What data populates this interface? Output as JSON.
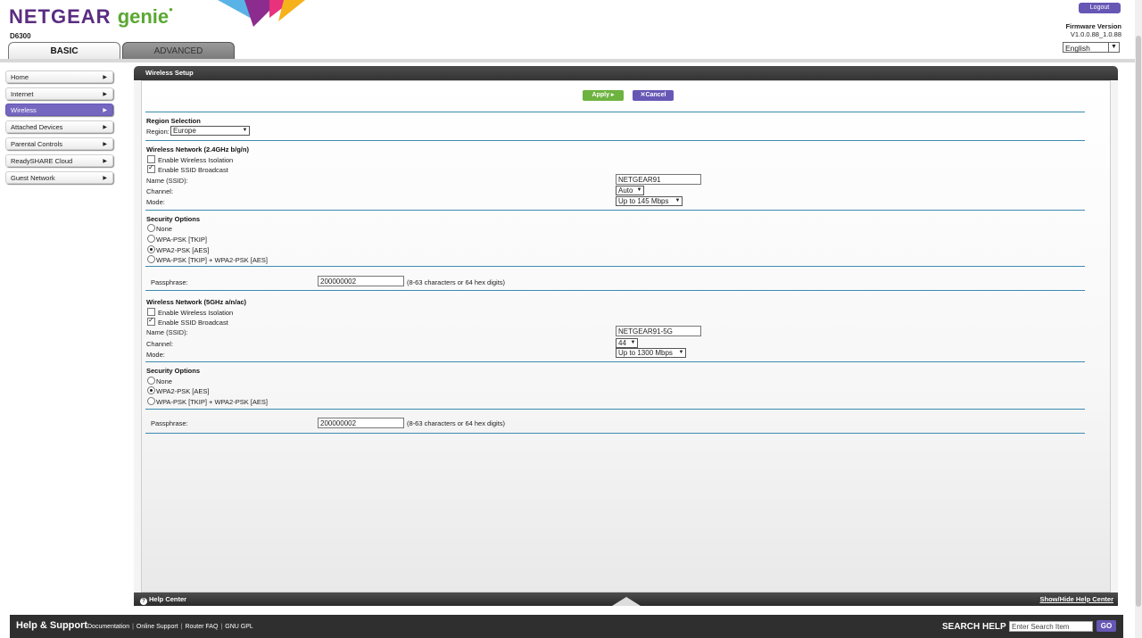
{
  "header": {
    "brand": "NETGEAR",
    "product": "genie",
    "model": "D6300",
    "logout_label": "Logout",
    "firmware_label": "Firmware Version",
    "firmware_value": "V1.0.0.88_1.0.88",
    "language": "English",
    "tabs": [
      {
        "label": "BASIC",
        "active": true
      },
      {
        "label": "ADVANCED",
        "active": false
      }
    ]
  },
  "sidebar": {
    "items": [
      {
        "label": "Home"
      },
      {
        "label": "Internet"
      },
      {
        "label": "Wireless",
        "active": true
      },
      {
        "label": "Attached Devices"
      },
      {
        "label": "Parental Controls"
      },
      {
        "label": "ReadySHARE Cloud"
      },
      {
        "label": "Guest Network"
      }
    ]
  },
  "main": {
    "title": "Wireless Setup",
    "apply_label": "Apply ▸",
    "cancel_label": "Cancel",
    "region": {
      "section": "Region Selection",
      "label": "Region:",
      "value": "Europe"
    },
    "wifi24": {
      "section": "Wireless Network (2.4GHz b/g/n)",
      "isolation_label": "Enable Wireless Isolation",
      "isolation_checked": false,
      "ssid_broadcast_label": "Enable SSID Broadcast",
      "ssid_broadcast_checked": true,
      "name_label": "Name (SSID):",
      "name_value": "NETGEAR91",
      "channel_label": "Channel:",
      "channel_value": "Auto",
      "mode_label": "Mode:",
      "mode_value": "Up to 145 Mbps",
      "security": {
        "section": "Security Options",
        "options": [
          "None",
          "WPA-PSK [TKIP]",
          "WPA2-PSK [AES]",
          "WPA-PSK [TKIP] + WPA2-PSK [AES]"
        ],
        "selected": "WPA2-PSK [AES]"
      },
      "passphrase_label": "Passphrase:",
      "passphrase_value": "200000002",
      "passphrase_hint": "(8-63 characters or 64 hex digits)"
    },
    "wifi5": {
      "section": "Wireless Network (5GHz a/n/ac)",
      "isolation_label": "Enable Wireless Isolation",
      "isolation_checked": false,
      "ssid_broadcast_label": "Enable SSID Broadcast",
      "ssid_broadcast_checked": true,
      "name_label": "Name (SSID):",
      "name_value": "NETGEAR91-5G",
      "channel_label": "Channel:",
      "channel_value": "44",
      "mode_label": "Mode:",
      "mode_value": "Up to 1300 Mbps",
      "security": {
        "section": "Security Options",
        "options": [
          "None",
          "WPA2-PSK [AES]",
          "WPA-PSK [TKIP] + WPA2-PSK [AES]"
        ],
        "selected": "WPA2-PSK [AES]"
      },
      "passphrase_label": "Passphrase:",
      "passphrase_value": "200000002",
      "passphrase_hint": "(8-63 characters or 64 hex digits)"
    }
  },
  "helpbar": {
    "help_center_label": "Help Center",
    "show_hide_label": "Show/Hide Help Center"
  },
  "footer": {
    "title": "Help & Support",
    "links": [
      "Documentation",
      "Online Support",
      "Router FAQ",
      "GNU GPL"
    ],
    "search_label": "SEARCH HELP",
    "search_placeholder": "Enter Search Item",
    "go_label": "GO"
  },
  "colors": {
    "brand_purple": "#5a2d82",
    "accent_purple": "#6757b5",
    "apply_green": "#6db33f",
    "section_line": "#3c8bb0"
  }
}
